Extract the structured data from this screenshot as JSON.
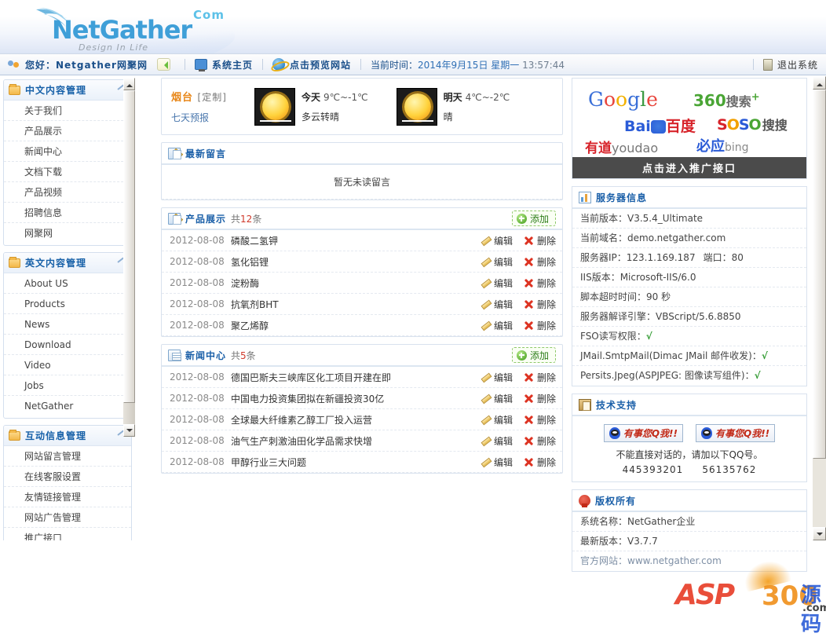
{
  "brand": {
    "name_net": "Net",
    "name_gather": "Gather",
    "com": "Com",
    "tagline": "Design In Life"
  },
  "topbar": {
    "greeting": "您好：Netgather网聚网",
    "back_icon": "back-arrow-icon",
    "home": "系统主页",
    "preview": "点击预览网站",
    "time_label": "当前时间：",
    "time_date": "2014年9月15日 星期一",
    "time_clock": "13:57:44",
    "logout": "退出系统"
  },
  "sidebar": {
    "groups": [
      {
        "title": "中文内容管理",
        "items": [
          "关于我们",
          "产品展示",
          "新闻中心",
          "文档下载",
          "产品视频",
          "招聘信息",
          "网聚网"
        ]
      },
      {
        "title": "英文内容管理",
        "items": [
          "About US",
          "Products",
          "News",
          "Download",
          "Video",
          "Jobs",
          "NetGather"
        ]
      },
      {
        "title": "互动信息管理",
        "items": [
          "网站留言管理",
          "在线客服设置",
          "友情链接管理",
          "网站广告管理",
          "推广接口"
        ]
      }
    ]
  },
  "weather": {
    "city": "烟台",
    "custom": "[定制]",
    "forecast_link": "七天预报",
    "today": {
      "label": "今天",
      "temp": "9℃~-1℃",
      "cond": "多云转晴"
    },
    "tomorrow": {
      "label": "明天",
      "temp": "4℃~-2℃",
      "cond": "晴"
    }
  },
  "messages": {
    "title": "最新留言",
    "empty": "暂无未读留言"
  },
  "products": {
    "title": "产品展示",
    "count_prefix": "共",
    "count": "12",
    "count_suffix": "条",
    "add_label": "添加",
    "edit_label": "编辑",
    "delete_label": "删除",
    "rows": [
      {
        "date": "2012-08-08",
        "title": "磷酸二氢钾"
      },
      {
        "date": "2012-08-08",
        "title": "氢化铝锂"
      },
      {
        "date": "2012-08-08",
        "title": "淀粉酶"
      },
      {
        "date": "2012-08-08",
        "title": "抗氧剂BHT"
      },
      {
        "date": "2012-08-08",
        "title": "聚乙烯醇"
      }
    ]
  },
  "news": {
    "title": "新闻中心",
    "count_prefix": "共",
    "count": "5",
    "count_suffix": "条",
    "add_label": "添加",
    "edit_label": "编辑",
    "delete_label": "删除",
    "rows": [
      {
        "date": "2012-08-08",
        "title": "德国巴斯夫三峡库区化工项目开建在即"
      },
      {
        "date": "2012-08-08",
        "title": "中国电力投资集团拟在新疆投资30亿"
      },
      {
        "date": "2012-08-08",
        "title": "全球最大纤维素乙醇工厂投入运营"
      },
      {
        "date": "2012-08-08",
        "title": "油气生产刺激油田化学品需求快增"
      },
      {
        "date": "2012-08-08",
        "title": "甲醇行业三大问题"
      }
    ]
  },
  "promo": {
    "engines": {
      "google": "Google",
      "qihoo360": "360搜索",
      "baidu": "百度",
      "soso": "搜搜",
      "youdao": "有道",
      "bing": "必应"
    },
    "button": "点击进入推广接口"
  },
  "server": {
    "title": "服务器信息",
    "rows": [
      "当前版本：V3.5.4_Ultimate",
      "当前域名：demo.netgather.com",
      "IIS版本：Microsoft-IIS/6.0",
      "脚本超时时间：90 秒",
      "服务器解译引擎：VBScript/5.6.8850"
    ],
    "ip_label": "服务器IP：",
    "ip_value": "123.1.169.187",
    "port_label": "端口：",
    "port_value": "80",
    "checks": [
      {
        "label": "FSO读写权限：",
        "ok": "√"
      },
      {
        "label": "JMail.SmtpMail(Dimac JMail 邮件收发)：",
        "ok": "√"
      },
      {
        "label": "Persits.Jpeg(ASPJPEG: 图像读写组件)：",
        "ok": "√"
      }
    ]
  },
  "support": {
    "title": "技术支持",
    "qq_button_label": "有事您Q我!!",
    "note": "不能直接对话的，请加以下QQ号。",
    "qq1": "445393201",
    "qq2": "56135762"
  },
  "copyright": {
    "title": "版权所有",
    "sys_name": "系统名称：NetGather企业",
    "version": "最新版本：V3.7.7",
    "website": "官方网站：www.netgather.com"
  },
  "watermark": {
    "asp": "ASP",
    "num": "300",
    "cn": "源码",
    "com": ".com"
  },
  "colors": {
    "accent": "#1a5fa8",
    "link": "#2f6fb5",
    "danger": "#d03a2c",
    "success": "#2f9a2f"
  }
}
